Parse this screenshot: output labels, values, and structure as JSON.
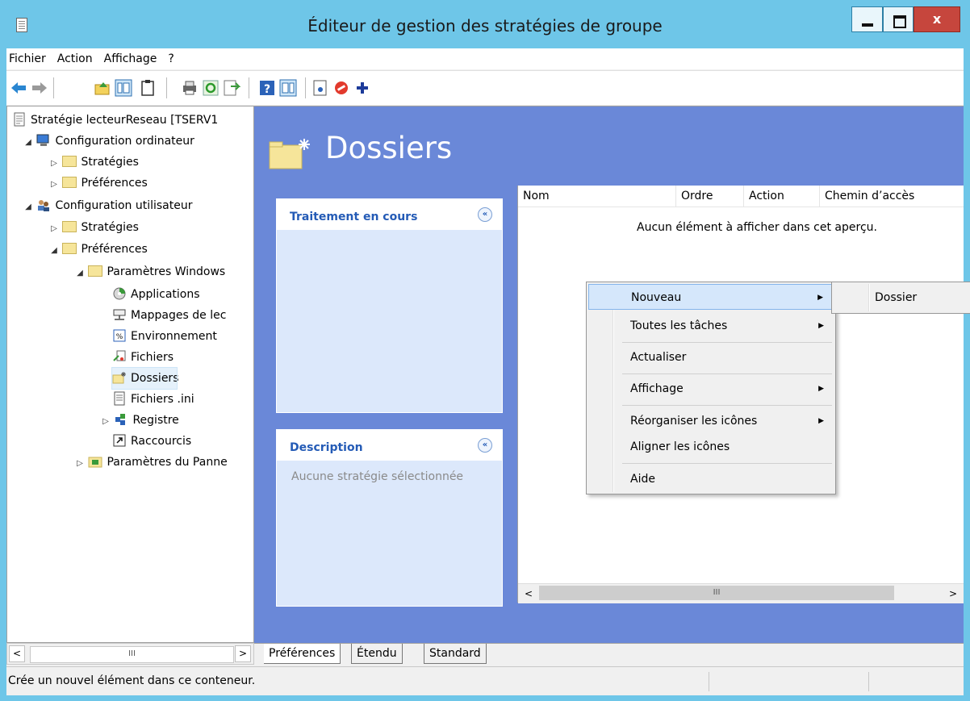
{
  "window": {
    "title": "Éditeur de gestion des stratégies de groupe",
    "minimize": "minimize",
    "maximize": "maximize",
    "close_label": "x"
  },
  "menu": [
    "Fichier",
    "Action",
    "Affichage",
    "?"
  ],
  "tree": {
    "root": "Stratégie lecteurReseau [TSERV1",
    "computer_config": "Configuration ordinateur",
    "computer_policies": "Stratégies",
    "computer_prefs": "Préférences",
    "user_config": "Configuration utilisateur",
    "user_policies": "Stratégies",
    "user_prefs": "Préférences",
    "windows_settings": "Paramètres Windows",
    "applications": "Applications",
    "drive_maps": "Mappages de lec",
    "environment": "Environnement",
    "files": "Fichiers",
    "folders": "Dossiers",
    "ini_files": "Fichiers .ini",
    "registry": "Registre",
    "shortcuts": "Raccourcis",
    "control_panel": "Paramètres du Panne"
  },
  "main": {
    "title": "Dossiers",
    "processing_panel": {
      "title": "Traitement en cours",
      "collapse": "«"
    },
    "description_panel": {
      "title": "Description",
      "collapse": "«",
      "body": "Aucune stratégie sélectionnée"
    },
    "columns": [
      "Nom",
      "Ordre",
      "Action",
      "Chemin d’accès"
    ],
    "empty_text": "Aucun élément à afficher dans cet aperçu.",
    "scroll_left": "<",
    "scroll_right": ">",
    "scroll_grip": "III"
  },
  "context_menu": {
    "items": [
      "Nouveau",
      "Toutes les tâches",
      "Actualiser",
      "Affichage",
      "Réorganiser les icônes",
      "Aligner les icônes",
      "Aide"
    ],
    "submenu_arrow": "▶",
    "submenu_items": [
      "Dossier"
    ]
  },
  "tabs": [
    "Préférences",
    "Étendu",
    "Standard"
  ],
  "left_scroll": {
    "left": "<",
    "right": ">",
    "grip": "III"
  },
  "status": {
    "text": "Crée un nouvel élément dans ce conteneur."
  },
  "colors": {
    "titlebar": "#6ec6e8",
    "content_bg": "#6a88d8",
    "panel_title": "#245bb6",
    "menu_highlight": "#d5e7fb"
  }
}
